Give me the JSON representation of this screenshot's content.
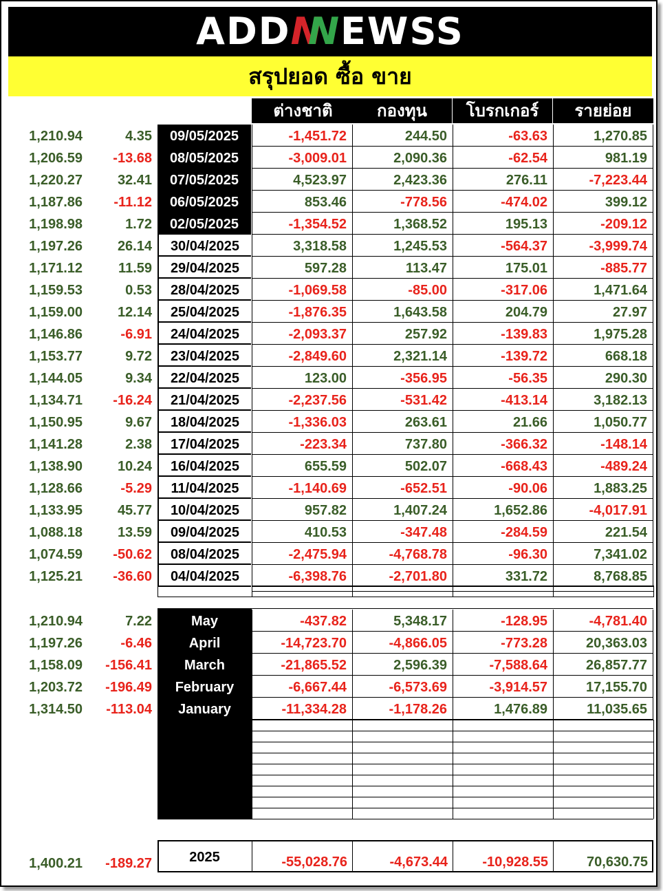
{
  "banner": {
    "logo_a": "ADD",
    "logo_n1": "N",
    "logo_n2": "N",
    "logo_b": "EWSS"
  },
  "subtitle": "สรุปยอด ซื้อ ขาย",
  "headers": [
    "ต่างชาติ",
    "กองทุน",
    "โบรกเกอร์",
    "รายย่อย"
  ],
  "colors": {
    "positive": "#3a5d28",
    "negative": "#e8231b",
    "banner_bg": "#000000",
    "subtitle_bg": "#ffff33"
  },
  "daily": [
    {
      "index": "1,210.94",
      "change": "4.35",
      "date": "09/05/2025",
      "dark": true,
      "v": [
        "-1,451.72",
        "244.50",
        "-63.63",
        "1,270.85"
      ]
    },
    {
      "index": "1,206.59",
      "change": "-13.68",
      "date": "08/05/2025",
      "dark": true,
      "v": [
        "-3,009.01",
        "2,090.36",
        "-62.54",
        "981.19"
      ]
    },
    {
      "index": "1,220.27",
      "change": "32.41",
      "date": "07/05/2025",
      "dark": true,
      "v": [
        "4,523.97",
        "2,423.36",
        "276.11",
        "-7,223.44"
      ]
    },
    {
      "index": "1,187.86",
      "change": "-11.12",
      "date": "06/05/2025",
      "dark": true,
      "v": [
        "853.46",
        "-778.56",
        "-474.02",
        "399.12"
      ]
    },
    {
      "index": "1,198.98",
      "change": "1.72",
      "date": "02/05/2025",
      "dark": true,
      "v": [
        "-1,354.52",
        "1,368.52",
        "195.13",
        "-209.12"
      ]
    },
    {
      "index": "1,197.26",
      "change": "26.14",
      "date": "30/04/2025",
      "dark": false,
      "v": [
        "3,318.58",
        "1,245.53",
        "-564.37",
        "-3,999.74"
      ]
    },
    {
      "index": "1,171.12",
      "change": "11.59",
      "date": "29/04/2025",
      "dark": false,
      "v": [
        "597.28",
        "113.47",
        "175.01",
        "-885.77"
      ]
    },
    {
      "index": "1,159.53",
      "change": "0.53",
      "date": "28/04/2025",
      "dark": false,
      "v": [
        "-1,069.58",
        "-85.00",
        "-317.06",
        "1,471.64"
      ]
    },
    {
      "index": "1,159.00",
      "change": "12.14",
      "date": "25/04/2025",
      "dark": false,
      "v": [
        "-1,876.35",
        "1,643.58",
        "204.79",
        "27.97"
      ]
    },
    {
      "index": "1,146.86",
      "change": "-6.91",
      "date": "24/04/2025",
      "dark": false,
      "v": [
        "-2,093.37",
        "257.92",
        "-139.83",
        "1,975.28"
      ]
    },
    {
      "index": "1,153.77",
      "change": "9.72",
      "date": "23/04/2025",
      "dark": false,
      "v": [
        "-2,849.60",
        "2,321.14",
        "-139.72",
        "668.18"
      ]
    },
    {
      "index": "1,144.05",
      "change": "9.34",
      "date": "22/04/2025",
      "dark": false,
      "v": [
        "123.00",
        "-356.95",
        "-56.35",
        "290.30"
      ]
    },
    {
      "index": "1,134.71",
      "change": "-16.24",
      "date": "21/04/2025",
      "dark": false,
      "v": [
        "-2,237.56",
        "-531.42",
        "-413.14",
        "3,182.13"
      ]
    },
    {
      "index": "1,150.95",
      "change": "9.67",
      "date": "18/04/2025",
      "dark": false,
      "v": [
        "-1,336.03",
        "263.61",
        "21.66",
        "1,050.77"
      ]
    },
    {
      "index": "1,141.28",
      "change": "2.38",
      "date": "17/04/2025",
      "dark": false,
      "v": [
        "-223.34",
        "737.80",
        "-366.32",
        "-148.14"
      ]
    },
    {
      "index": "1,138.90",
      "change": "10.24",
      "date": "16/04/2025",
      "dark": false,
      "v": [
        "655.59",
        "502.07",
        "-668.43",
        "-489.24"
      ]
    },
    {
      "index": "1,128.66",
      "change": "-5.29",
      "date": "11/04/2025",
      "dark": false,
      "v": [
        "-1,140.69",
        "-652.51",
        "-90.06",
        "1,883.25"
      ]
    },
    {
      "index": "1,133.95",
      "change": "45.77",
      "date": "10/04/2025",
      "dark": false,
      "v": [
        "957.82",
        "1,407.24",
        "1,652.86",
        "-4,017.91"
      ]
    },
    {
      "index": "1,088.18",
      "change": "13.59",
      "date": "09/04/2025",
      "dark": false,
      "v": [
        "410.53",
        "-347.48",
        "-284.59",
        "221.54"
      ]
    },
    {
      "index": "1,074.59",
      "change": "-50.62",
      "date": "08/04/2025",
      "dark": false,
      "v": [
        "-2,475.94",
        "-4,768.78",
        "-96.30",
        "7,341.02"
      ]
    },
    {
      "index": "1,125.21",
      "change": "-36.60",
      "date": "04/04/2025",
      "dark": false,
      "v": [
        "-6,398.76",
        "-2,701.80",
        "331.72",
        "8,768.85"
      ]
    }
  ],
  "monthly": [
    {
      "index": "1,210.94",
      "change": "7.22",
      "month": "May",
      "v": [
        "-437.82",
        "5,348.17",
        "-128.95",
        "-4,781.40"
      ]
    },
    {
      "index": "1,197.26",
      "change": "-6.46",
      "month": "April",
      "v": [
        "-14,723.70",
        "-4,866.05",
        "-773.28",
        "20,363.03"
      ]
    },
    {
      "index": "1,158.09",
      "change": "-156.41",
      "month": "March",
      "v": [
        "-21,865.52",
        "2,596.39",
        "-7,588.64",
        "26,857.77"
      ]
    },
    {
      "index": "1,203.72",
      "change": "-196.49",
      "month": "February",
      "v": [
        "-6,667.44",
        "-6,573.69",
        "-3,914.57",
        "17,155.70"
      ]
    },
    {
      "index": "1,314.50",
      "change": "-113.04",
      "month": "January",
      "v": [
        "-11,334.28",
        "-1,178.26",
        "1,476.89",
        "11,035.65"
      ]
    }
  ],
  "yearly": {
    "index": "1,400.21",
    "change": "-189.27",
    "year": "2025",
    "v": [
      "-55,028.76",
      "-4,673.44",
      "-10,928.55",
      "70,630.75"
    ]
  }
}
